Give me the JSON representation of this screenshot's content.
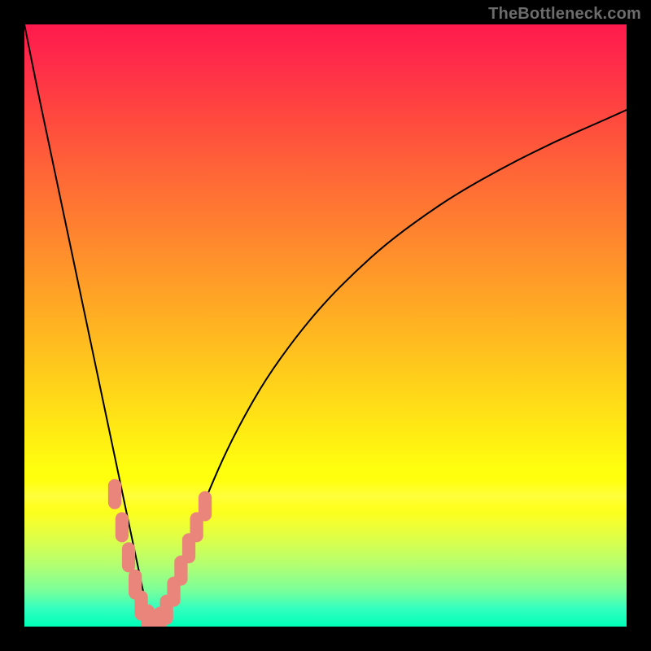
{
  "watermark": "TheBottleneck.com",
  "chart_data": {
    "type": "line",
    "title": "",
    "xlabel": "",
    "ylabel": "",
    "xlim": [
      0,
      100
    ],
    "ylim": [
      0,
      100
    ],
    "grid": false,
    "legend": false,
    "background_gradient": {
      "orientation": "vertical",
      "stops": [
        {
          "pos": 0.0,
          "color": "#ff1a4d"
        },
        {
          "pos": 0.14,
          "color": "#ff4440"
        },
        {
          "pos": 0.38,
          "color": "#ff8e2c"
        },
        {
          "pos": 0.62,
          "color": "#ffd918"
        },
        {
          "pos": 0.78,
          "color": "#ffff0e"
        },
        {
          "pos": 0.9,
          "color": "#b0ff74"
        },
        {
          "pos": 1.0,
          "color": "#00ffb7"
        }
      ]
    },
    "series": [
      {
        "name": "bottleneck-curve",
        "color": "#000000",
        "stroke_width": 2,
        "x": [
          0.0,
          2,
          4,
          6,
          8,
          10,
          12,
          14,
          16,
          18,
          19,
          20,
          21,
          22,
          23,
          24,
          26,
          28,
          30,
          33,
          36,
          40,
          45,
          50,
          55,
          60,
          66,
          72,
          80,
          88,
          96,
          100
        ],
        "y": [
          100,
          90,
          80.5,
          71,
          61.5,
          52,
          42.5,
          33,
          23.5,
          14,
          9.3,
          4.5,
          0.5,
          0.0,
          1.5,
          4.5,
          10.5,
          16,
          21,
          28,
          34,
          41,
          48,
          54,
          59,
          63.5,
          68,
          72,
          76.5,
          80.5,
          84,
          85.8
        ]
      }
    ],
    "markers": {
      "name": "highlight-pills",
      "color": "#e9857b",
      "shape": "capsule",
      "approx_width": 2.2,
      "approx_height": 5.0,
      "points": [
        {
          "x": 15.0,
          "y": 22.0
        },
        {
          "x": 16.2,
          "y": 16.5
        },
        {
          "x": 17.3,
          "y": 11.5
        },
        {
          "x": 18.4,
          "y": 7.0
        },
        {
          "x": 19.4,
          "y": 3.5
        },
        {
          "x": 20.5,
          "y": 1.2
        },
        {
          "x": 21.5,
          "y": 0.3
        },
        {
          "x": 22.5,
          "y": 0.8
        },
        {
          "x": 23.6,
          "y": 2.8
        },
        {
          "x": 24.8,
          "y": 5.8
        },
        {
          "x": 26.0,
          "y": 9.3
        },
        {
          "x": 27.3,
          "y": 13.0
        },
        {
          "x": 28.6,
          "y": 16.5
        },
        {
          "x": 30.0,
          "y": 20.0
        }
      ]
    }
  }
}
